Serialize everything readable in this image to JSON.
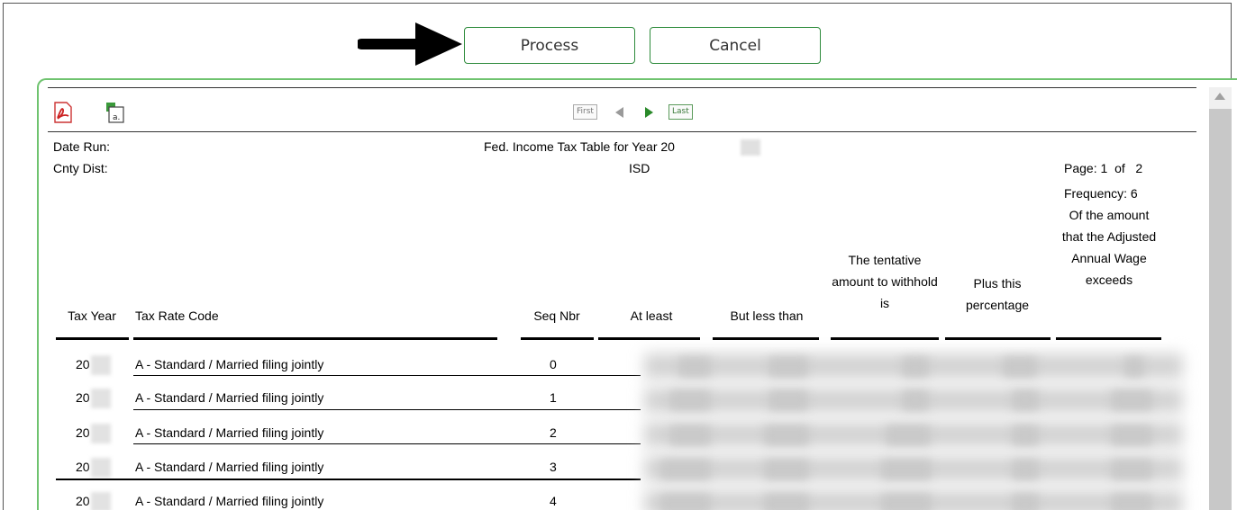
{
  "buttons": {
    "process": "Process",
    "cancel": "Cancel"
  },
  "toolbar": {
    "pdf_icon": "pdf-icon",
    "export_icon": "spreadsheet-export-icon",
    "nav_first": "First",
    "nav_last": "Last"
  },
  "report": {
    "date_run_label": "Date Run:",
    "cnty_dist_label": "Cnty Dist:",
    "title": "Fed. Income Tax Table for Year 20",
    "district": "ISD",
    "page_label": "Page:",
    "page_current": "1",
    "page_of": "of",
    "page_total": "2",
    "frequency": "Frequency: 6"
  },
  "table": {
    "headers": {
      "tax_year": "Tax Year",
      "tax_rate_code": "Tax Rate Code",
      "seq_nbr": "Seq Nbr",
      "at_least": "At least",
      "but_less_than": "But less than",
      "tentative": "The tentative amount to withhold is",
      "plus_pct": "Plus this percentage",
      "of_amount": "Of the amount that the Adjusted Annual Wage exceeds"
    },
    "rows": [
      {
        "year": "20",
        "code": "A - Standard / Married filing jointly",
        "seq": "0"
      },
      {
        "year": "20",
        "code": "A - Standard / Married filing jointly",
        "seq": "1"
      },
      {
        "year": "20",
        "code": "A - Standard / Married filing jointly",
        "seq": "2"
      },
      {
        "year": "20",
        "code": "A - Standard / Married filing jointly",
        "seq": "3"
      },
      {
        "year": "20",
        "code": "A - Standard / Married filing jointly",
        "seq": "4"
      }
    ]
  },
  "colors": {
    "accent_green": "#2e8b3c",
    "viewer_border": "#6fc36f"
  }
}
